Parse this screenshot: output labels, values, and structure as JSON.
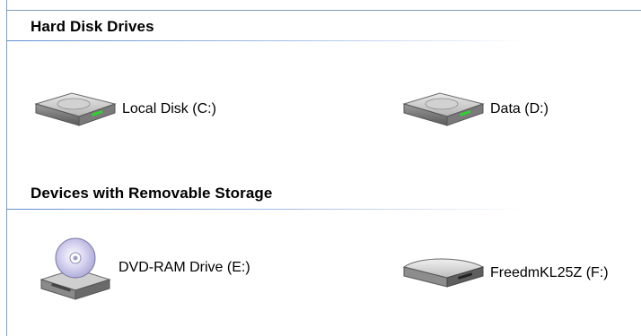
{
  "sections": [
    {
      "title": "Hard Disk Drives",
      "items": [
        {
          "label": "Local Disk (C:)",
          "icon": "hard-disk-icon"
        },
        {
          "label": "Data (D:)",
          "icon": "hard-disk-icon"
        }
      ]
    },
    {
      "title": "Devices with Removable Storage",
      "items": [
        {
          "label": "DVD-RAM Drive (E:)",
          "icon": "dvd-drive-icon"
        },
        {
          "label": "FreedmKL25Z (F:)",
          "icon": "removable-disk-icon"
        }
      ]
    }
  ],
  "colors": {
    "section_rule": "#5f8fd0",
    "border": "#7f9db9"
  }
}
